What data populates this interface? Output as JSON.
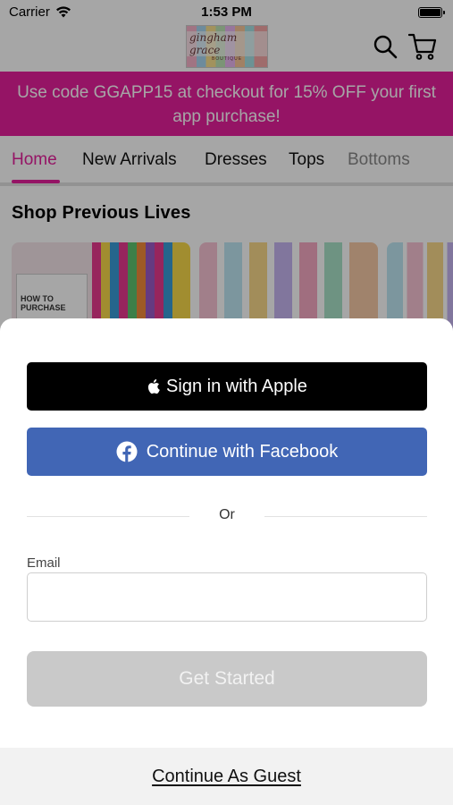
{
  "status_bar": {
    "carrier": "Carrier",
    "time": "1:53 PM"
  },
  "header": {
    "logo_text": "gingham grace",
    "logo_subtext": "BOUTIQUE",
    "icons": [
      "search-icon",
      "cart-icon"
    ]
  },
  "promo_banner": {
    "text": "Use code GGAPP15 at checkout for 15% OFF your first app purchase!"
  },
  "nav_tabs": {
    "items": [
      {
        "label": "Home",
        "active": true
      },
      {
        "label": "New Arrivals",
        "active": false
      },
      {
        "label": "Dresses",
        "active": false
      },
      {
        "label": "Tops",
        "active": false
      },
      {
        "label": "Bottoms",
        "active": false
      }
    ]
  },
  "section": {
    "title": "Shop Previous Lives",
    "card1_text": "HOW TO PURCHASE"
  },
  "sheet": {
    "apple_button": "Sign in with Apple",
    "facebook_button": "Continue with Facebook",
    "divider_text": "Or",
    "email_label": "Email",
    "email_value": "",
    "email_placeholder": "",
    "submit_button": "Get Started",
    "guest_link": "Continue As Guest"
  },
  "colors": {
    "brand_pink": "#e51f9c",
    "facebook_blue": "#4166b5",
    "disabled_gray": "#c9c9c9"
  }
}
